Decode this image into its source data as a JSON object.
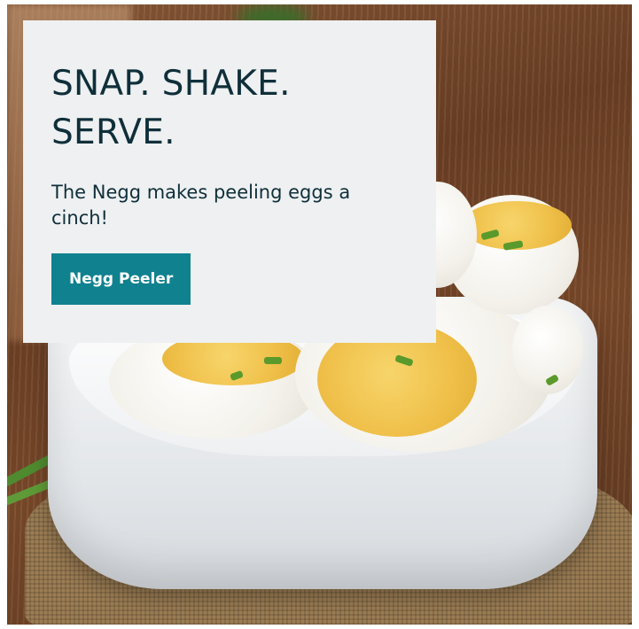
{
  "hero": {
    "headline_line1": "SNAP. SHAKE.",
    "headline_line2": "SERVE.",
    "subtitle": "The Negg makes peeling eggs a cinch!",
    "cta_label": "Negg Peeler"
  },
  "colors": {
    "panel_background": "#eef0f1",
    "text": "#0f2f3a",
    "button_background": "#10818f",
    "button_text": "#ffffff"
  },
  "images": {
    "hero_photo": "boiled-eggs-in-white-bowl-photo"
  }
}
